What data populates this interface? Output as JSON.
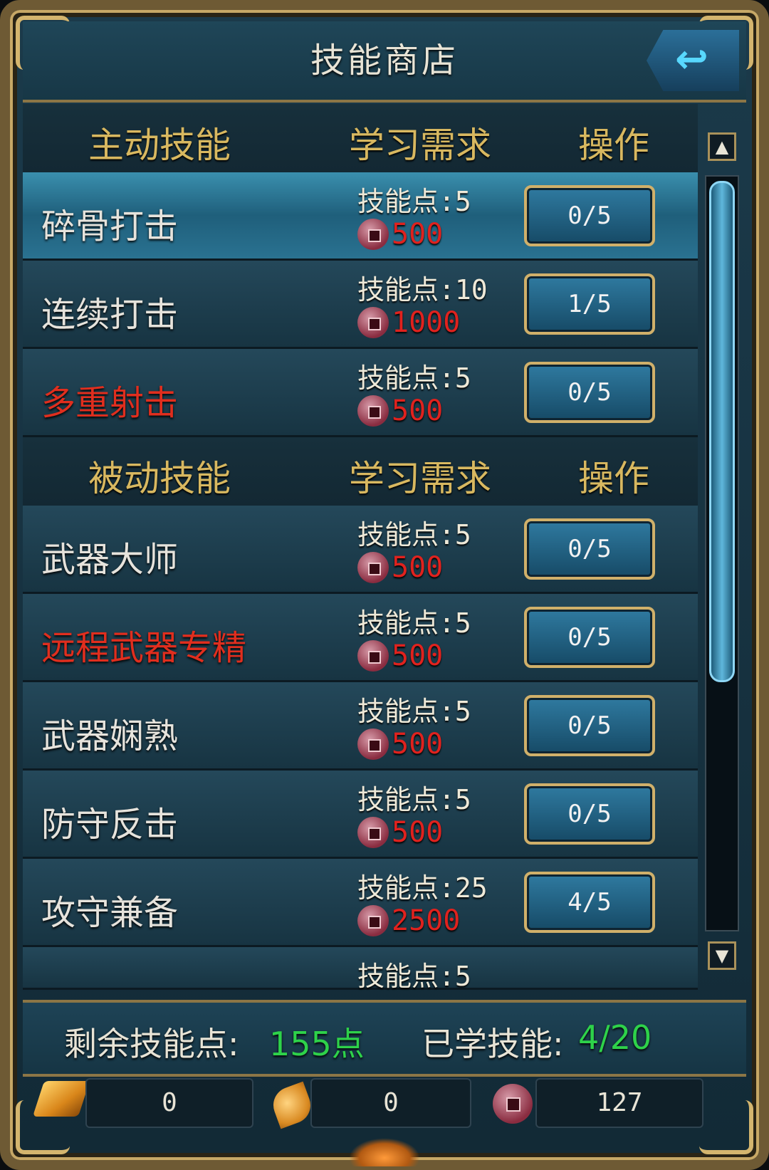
{
  "header": {
    "title": "技能商店"
  },
  "active_section": {
    "col_name": "主动技能",
    "col_req": "学习需求",
    "col_op": "操作"
  },
  "active_skills": [
    {
      "name": "碎骨打击",
      "req": "技能点:5",
      "cost": "500",
      "progress": "0/5",
      "highlight": false,
      "selected": true
    },
    {
      "name": "连续打击",
      "req": "技能点:10",
      "cost": "1000",
      "progress": "1/5",
      "highlight": false,
      "selected": false
    },
    {
      "name": "多重射击",
      "req": "技能点:5",
      "cost": "500",
      "progress": "0/5",
      "highlight": true,
      "selected": false
    }
  ],
  "passive_section": {
    "col_name": "被动技能",
    "col_req": "学习需求",
    "col_op": "操作"
  },
  "passive_skills": [
    {
      "name": "武器大师",
      "req": "技能点:5",
      "cost": "500",
      "progress": "0/5",
      "highlight": false
    },
    {
      "name": "远程武器专精",
      "req": "技能点:5",
      "cost": "500",
      "progress": "0/5",
      "highlight": true
    },
    {
      "name": "武器娴熟",
      "req": "技能点:5",
      "cost": "500",
      "progress": "0/5",
      "highlight": false
    },
    {
      "name": "防守反击",
      "req": "技能点:5",
      "cost": "500",
      "progress": "0/5",
      "highlight": false
    },
    {
      "name": "攻守兼备",
      "req": "技能点:25",
      "cost": "2500",
      "progress": "4/5",
      "highlight": false
    },
    {
      "name": "",
      "req": "技能点:5",
      "cost": "",
      "progress": "",
      "highlight": false
    }
  ],
  "footer": {
    "remaining_label": "剩余技能点:",
    "remaining_value": "155点",
    "learned_label": "已学技能:",
    "learned_value": "4/20"
  },
  "currency": {
    "gold": "0",
    "leaf": "0",
    "coin": "127"
  },
  "colors": {
    "highlight_name": "#e02e1e",
    "cost": "#e0221e",
    "green_value": "#2ed24a",
    "header_gold": "#d8b860"
  },
  "icons": {
    "back": "back-arrow-icon",
    "scroll_up": "scroll-up-icon",
    "scroll_down": "scroll-down-icon",
    "coin": "copper-coin-icon",
    "gold": "gold-ingot-icon",
    "leaf": "golden-leaf-icon"
  }
}
